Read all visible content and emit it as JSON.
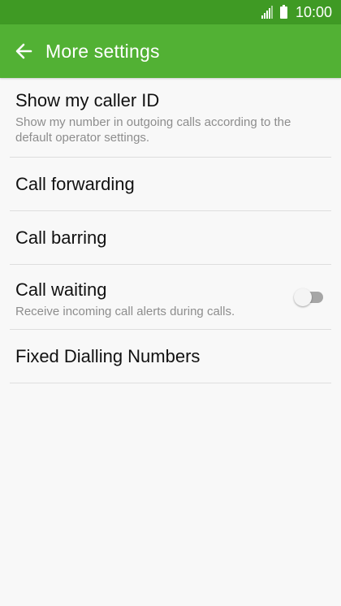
{
  "status_bar": {
    "time": "10:00",
    "icons": [
      "signal-icon",
      "battery-icon"
    ]
  },
  "app_bar": {
    "title": "More settings",
    "back_icon": "back-arrow-icon"
  },
  "colors": {
    "status_bar": "#3f9a24",
    "app_bar": "#52b134",
    "background": "#f8f8f8",
    "toggle_track_off": "#a6a6a6"
  },
  "settings": {
    "show_caller_id": {
      "label": "Show my caller ID",
      "description": "Show my number in outgoing calls according to the default operator settings."
    },
    "call_forwarding": {
      "label": "Call forwarding"
    },
    "call_barring": {
      "label": "Call barring"
    },
    "call_waiting": {
      "label": "Call waiting",
      "description": "Receive incoming call alerts during calls.",
      "toggle_on": false
    },
    "fixed_dialling": {
      "label": "Fixed Dialling Numbers"
    }
  }
}
